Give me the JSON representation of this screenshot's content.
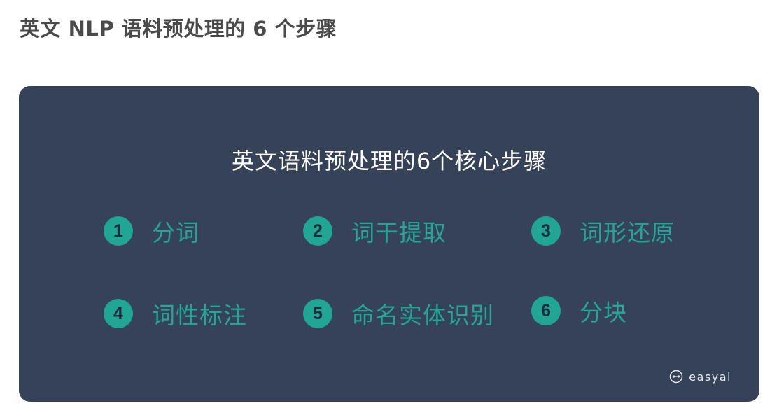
{
  "page": {
    "title": "英文 NLP 语料预处理的 6 个步骤"
  },
  "card": {
    "title": "英文语料预处理的6个核心步骤",
    "steps": [
      {
        "number": "1",
        "label": "分词"
      },
      {
        "number": "2",
        "label": "词干提取"
      },
      {
        "number": "3",
        "label": "词形还原"
      },
      {
        "number": "4",
        "label": "词性标注"
      },
      {
        "number": "5",
        "label": "命名实体识别"
      },
      {
        "number": "6",
        "label": "分块"
      }
    ],
    "brand": {
      "name": "easyai",
      "icon": "easyai-logo-icon"
    }
  },
  "colors": {
    "card_background": "#354257",
    "accent": "#21a594",
    "page_title": "#4a4a4a"
  }
}
